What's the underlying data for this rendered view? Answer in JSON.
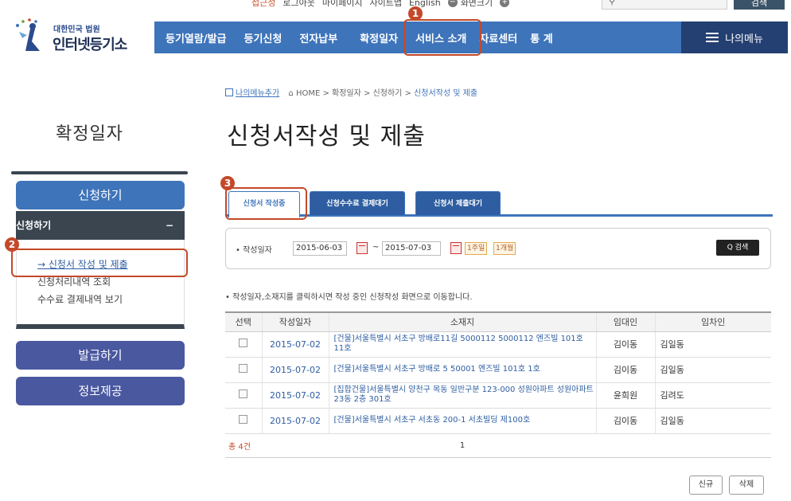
{
  "utility": {
    "items": [
      "접근성",
      "로그아웃",
      "마이페이지",
      "사이트맵",
      "English"
    ],
    "font_small": "−",
    "font_label": "화면크기",
    "font_large": "+",
    "search_button": "검색"
  },
  "logo": {
    "line1": "대한민국 법원",
    "line2": "인터넷등기소"
  },
  "nav": {
    "items": [
      "등기열람/발급",
      "등기신청",
      "전자납부",
      "확정일자",
      "서비스 소개",
      "자료센터",
      "통 계"
    ],
    "my_menu": "나의메뉴"
  },
  "badges": [
    "1",
    "2",
    "3"
  ],
  "breadcrumb": {
    "add_menu": "나의메뉴추가",
    "path": "HOME > 확정일자 > 신청하기 > ",
    "current": "신청서작성 및 제출"
  },
  "sidebar": {
    "title": "확정일자",
    "btn_apply": "신청하기",
    "sub_header": "신청하기",
    "sub_toggle": "−",
    "links": [
      "→ 신청서 작성 및 제출",
      "신청처리내역 조회",
      "수수료 결제내역 보기"
    ],
    "btn_issue": "발급하기",
    "btn_info": "정보제공"
  },
  "page_title": "신청서작성 및 제출",
  "tabs": [
    "신청서 작성중",
    "신청수수료 결제대기",
    "신청서 제출대기"
  ],
  "filter": {
    "label": "• 작성일자",
    "from": "2015-06-03",
    "sep": "~",
    "to": "2015-07-03",
    "week": "1주일",
    "month": "1개월",
    "search": "Q 검색"
  },
  "note": "• 작성일자,소재지를 클릭하시면 작성 중인 신청작성 화면으로 이동합니다.",
  "table": {
    "headers": [
      "선택",
      "작성일자",
      "소재지",
      "임대인",
      "임차인"
    ],
    "rows": [
      {
        "date": "2015-07-02",
        "addr": "[건물]서울특별시 서초구 방배로11길 5000112 5000112 엔즈빌 101호 11호",
        "landlord": "김이동",
        "tenant": "김일동"
      },
      {
        "date": "2015-07-02",
        "addr": "[건물]서울특별시 서초구 방배로 5 50001 엔즈빌 101호 1호",
        "landlord": "김이동",
        "tenant": "김일동"
      },
      {
        "date": "2015-07-02",
        "addr": "[집합건물]서울특별시 양천구 목동 일반구분 123-000 성원아파트 성원아파트 23동 2층 301호",
        "landlord": "윤희원",
        "tenant": "김려도"
      },
      {
        "date": "2015-07-02",
        "addr": "[건물]서울특별시 서초구 서초동 200-1 서초빌딩 제100호",
        "landlord": "김이동",
        "tenant": "김일동"
      }
    ],
    "total": "총 4건",
    "page": "1"
  },
  "buttons": {
    "new": "신규",
    "delete": "삭제"
  }
}
